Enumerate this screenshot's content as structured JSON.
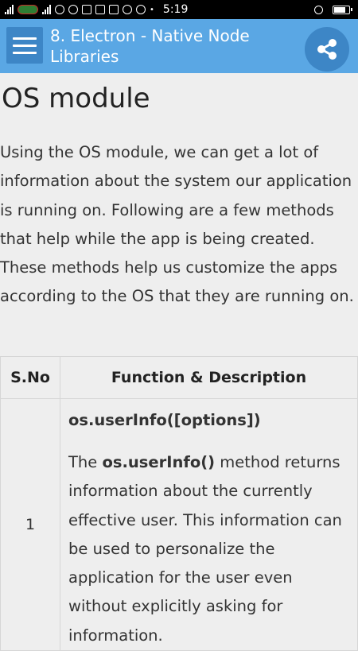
{
  "status_bar": {
    "time": "5:19"
  },
  "app_bar": {
    "title": "8. Electron - Native Node Libraries"
  },
  "page": {
    "heading": "OS module",
    "intro": "Using the OS module, we can get a lot of information about the system our application is running on. Following are a few methods that help while the app is being created. These methods help us customize the apps according to the OS that they are running on."
  },
  "table": {
    "headers": [
      "S.No",
      "Function & Description"
    ],
    "rows": [
      {
        "sno": "1",
        "function": "os.userInfo([options])",
        "desc_pre": "The ",
        "desc_bold": "os.userInfo()",
        "desc_post": " method returns information about the currently effective user. This information can be used to personalize the application for the user even without explicitly asking for information."
      }
    ]
  },
  "colors": {
    "app_bar": "#5aa7e4",
    "button_bg": "#3d86c6",
    "page_bg": "#eeeeee"
  }
}
